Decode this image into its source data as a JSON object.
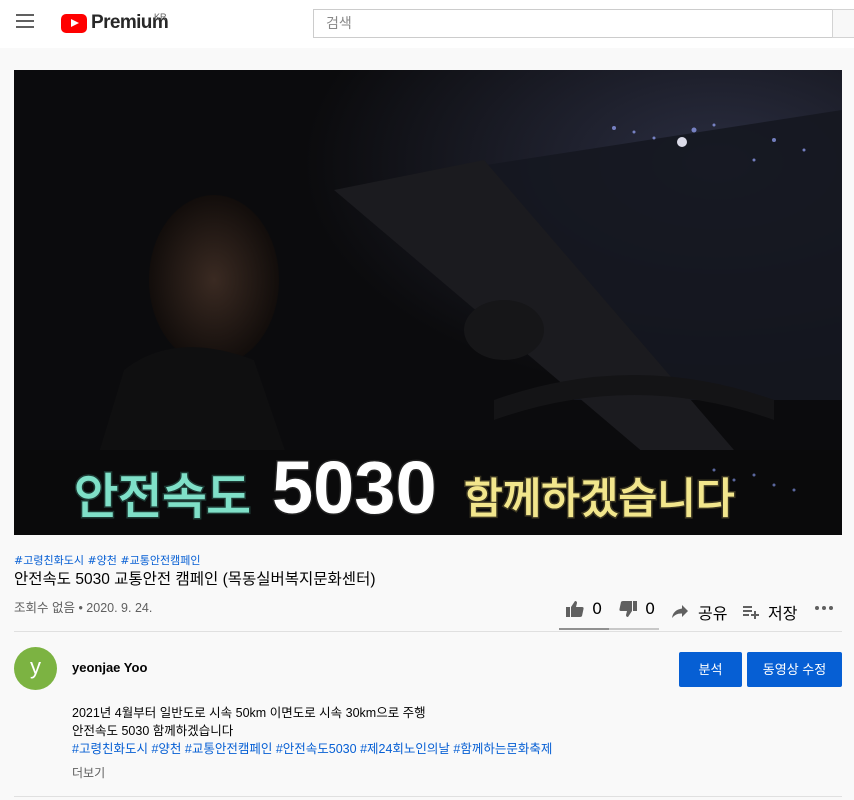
{
  "header": {
    "logo_text": "Premium",
    "region": "KR",
    "search_placeholder": "검색"
  },
  "video": {
    "caption_part1": "안전속도",
    "caption_number": "5030",
    "caption_part2": "함께하겠습니다"
  },
  "tags_top": [
    "#고령친화도시",
    "#양천",
    "#교통안전캠페인"
  ],
  "title": "안전속도 5030 교통안전 캠페인 (목동실버복지문화센터)",
  "meta": "조회수 없음 • 2020. 9. 24.",
  "actions": {
    "like_count": "0",
    "dislike_count": "0",
    "share_label": "공유",
    "save_label": "저장"
  },
  "channel": {
    "avatar_letter": "y",
    "name": "yeonjae Yoo"
  },
  "buttons": {
    "analytics": "분석",
    "edit_video": "동영상 수정"
  },
  "description": {
    "line1": "2021년 4월부터 일반도로 시속 50km 이면도로 시속 30km으로 주행",
    "line2": "안전속도 5030 함께하겠습니다",
    "tags": [
      "#고령친화도시",
      "#양천",
      "#교통안전캠페인",
      "#안전속도5030",
      "#제24회노인의날",
      "#함께하는문화축제"
    ],
    "more_label": "더보기"
  },
  "colors": {
    "accent": "#065fd4",
    "brand_red": "#ff0000",
    "caption_teal": "#7fe0c8",
    "caption_yellow": "#f2e68c",
    "avatar_green": "#7cb342"
  }
}
